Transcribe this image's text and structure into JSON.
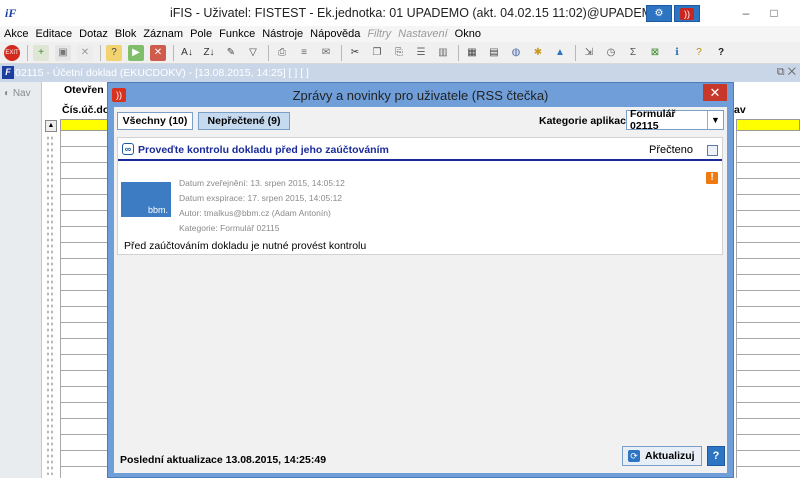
{
  "window": {
    "title": "iFIS - Uživatel: FISTEST - Ek.jednotka: 01 UPADEMO (akt. 04.02.15 11:02)@UPADEMO",
    "app_icon": "iF"
  },
  "menu": [
    {
      "label": "Akce",
      "enabled": true
    },
    {
      "label": "Editace",
      "enabled": true
    },
    {
      "label": "Dotaz",
      "enabled": true
    },
    {
      "label": "Blok",
      "enabled": true
    },
    {
      "label": "Záznam",
      "enabled": true
    },
    {
      "label": "Pole",
      "enabled": true
    },
    {
      "label": "Funkce",
      "enabled": true
    },
    {
      "label": "Nástroje",
      "enabled": true
    },
    {
      "label": "Nápověda",
      "enabled": true
    },
    {
      "label": "Filtry",
      "enabled": false
    },
    {
      "label": "Nastavení",
      "enabled": false
    },
    {
      "label": "Okno",
      "enabled": true
    }
  ],
  "mdi": {
    "title": "02115 - Účetní doklad (EKUCDOKV) - [13.08.2015, 14:25] [ ] [ ]"
  },
  "nav_label": "Nav",
  "form": {
    "header_open": "Otevřen",
    "col_doc": "Čís.úč.do",
    "col_right": "av"
  },
  "dialog": {
    "title": "Zprávy a novinky pro uživatele (RSS čtečka)",
    "tabs": {
      "all": "Všechny (10)",
      "unread": "Nepřečtené (9)"
    },
    "category_label": "Kategorie aplikace",
    "category_value": "Formulář 02115",
    "news": {
      "title": "Proveďte kontrolu dokladu před jeho zaúčtováním",
      "read_label": "Přečteno",
      "thumb_label": "bbm.",
      "published": "Datum zveřejnění: 13. srpen 2015, 14:05:12",
      "expires": "Datum exspirace: 17. srpen 2015, 14:05:12",
      "author": "Autor: tmalkus@bbm.cz (Adam Antonín)",
      "category": "Kategorie: Formulář 02115",
      "text": "Před zaúčtováním dokladu je nutné provést kontrolu"
    },
    "last_update": "Poslední aktualizace 13.08.2015, 14:25:49",
    "refresh_label": "Aktualizuj",
    "help_label": "?"
  },
  "colors": {
    "accent": "#2d74c2",
    "dialog_frame": "#6f9ed9",
    "link": "#1a2a9a",
    "warning": "#f07a10",
    "highlight": "#ffff00",
    "close": "#c7382b"
  }
}
